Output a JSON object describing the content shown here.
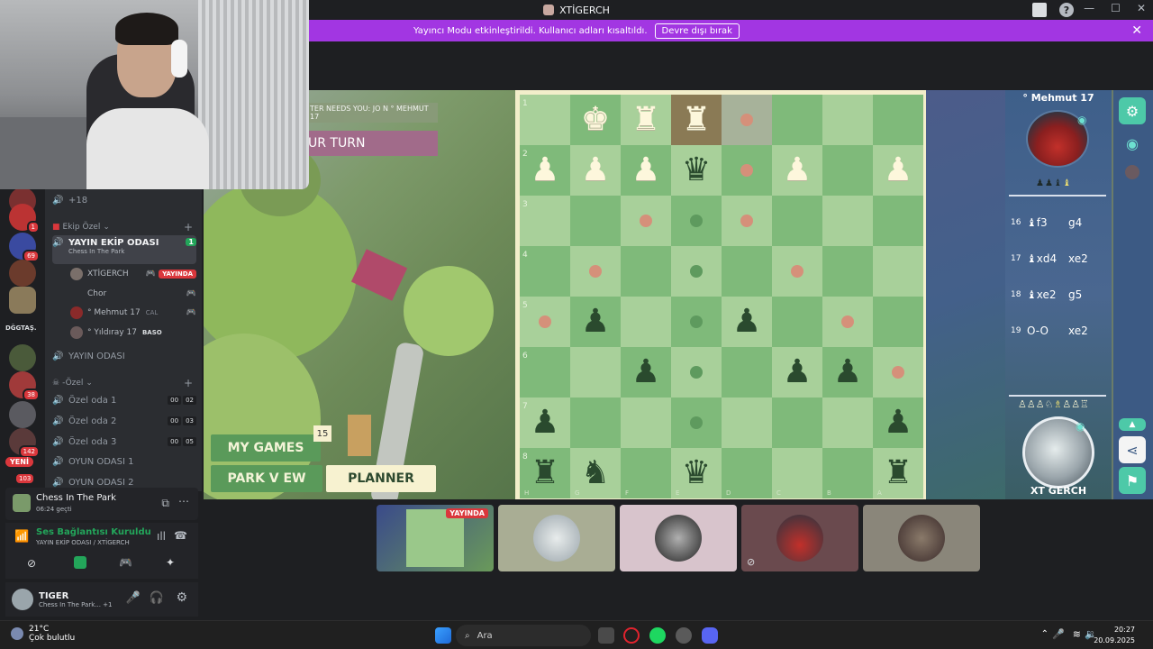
{
  "window": {
    "title": "XTİGERCH"
  },
  "notice": {
    "text": "Yayıncı Modu etkinleştirildi. Kullanıcı adları kısaltıldı.",
    "button": "Devre dışı bırak"
  },
  "rail": {
    "badges": [
      "1",
      "69",
      "38",
      "142",
      "103"
    ],
    "text_item": "DĞGTAŞ.",
    "new_label": "YENİ"
  },
  "channels": {
    "overflow": "+18",
    "category1": "Ekip Özel",
    "active_channel": "YAYIN EKİP ODASI",
    "active_sub": "Chess In The Park",
    "users": [
      {
        "name": "XTİGERCH",
        "tag": "YAYINDA"
      },
      {
        "name": "Chor",
        "tag": ""
      },
      {
        "name": "° Mehmut 17",
        "tag": "CAL"
      },
      {
        "name": "° Yıldıray 17",
        "tag": "BASO"
      }
    ],
    "yayin_odasi": "YAYIN ODASI",
    "category2": "-Özel",
    "rooms": [
      {
        "name": "Özel oda 1",
        "a": "00",
        "b": "02"
      },
      {
        "name": "Özel oda 2",
        "a": "00",
        "b": "03"
      },
      {
        "name": "Özel oda 3",
        "a": "00",
        "b": "05"
      },
      {
        "name": "OYUN ODASI 1",
        "a": "",
        "b": ""
      },
      {
        "name": "OYUN ODASI 2",
        "a": "",
        "b": ""
      }
    ]
  },
  "activity": {
    "title": "Chess In The Park",
    "time": "06:24 geçti"
  },
  "voice": {
    "status": "Ses Bağlantısı Kuruldu",
    "channel": "YAYIN EKİP ODASI / XTİGERCH"
  },
  "me": {
    "name": "TIGER",
    "status": "Chess In The Park...",
    "extra": "+1"
  },
  "game": {
    "msg": "TER NEEDS YOU: JO N ° MEHMUT 17",
    "turn": "UR TURN",
    "my_games": "MY GAMES",
    "counter": "15",
    "park_view": "PARK V EW",
    "planner": "PLANNER",
    "opponent": "° Mehmut 17",
    "player": "XT GERCH",
    "moves": [
      {
        "n": "16",
        "w": "♝f3",
        "b": "g4"
      },
      {
        "n": "17",
        "w": "♝xd4",
        "b": "xe2"
      },
      {
        "n": "18",
        "w": "♝xe2",
        "b": "g5"
      },
      {
        "n": "19",
        "w": "O-O",
        "b": "xe2"
      }
    ],
    "ranks": [
      "1",
      "2",
      "3",
      "4",
      "5",
      "6",
      "7",
      "8"
    ],
    "files": [
      "H",
      "G",
      "F",
      "E",
      "D",
      "C",
      "B",
      "A"
    ]
  },
  "strip": {
    "live": "YAYINDA"
  },
  "taskbar": {
    "temp": "21°C",
    "weather": "Çok bulutlu",
    "search": "Ara",
    "time": "20:27",
    "date": "20.09.2025"
  },
  "colors": {
    "accent": "#a236e2",
    "live": "#da373c",
    "board_light": "#a8d09a",
    "board_dark": "#7fba7a"
  }
}
